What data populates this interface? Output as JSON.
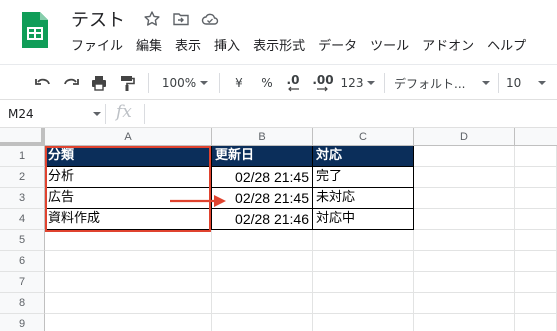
{
  "header": {
    "title": "テスト",
    "menu": [
      "ファイル",
      "編集",
      "表示",
      "挿入",
      "表示形式",
      "データ",
      "ツール",
      "アドオン",
      "ヘルプ"
    ]
  },
  "toolbar": {
    "zoom": "100%",
    "currency": "¥",
    "percent": "%",
    "decrease_decimal": ".0",
    "increase_decimal": ".00",
    "number_format": "123",
    "font": "デフォルト...",
    "font_size": "10"
  },
  "formula_bar": {
    "name_box": "M24",
    "fx": "fx"
  },
  "grid": {
    "columns": [
      "A",
      "B",
      "C",
      "D"
    ],
    "rows": [
      "1",
      "2",
      "3",
      "4",
      "5",
      "6",
      "7",
      "8",
      "9"
    ],
    "cells": [
      [
        "分類",
        "更新日",
        "対応"
      ],
      [
        "分析",
        "02/28 21:45",
        "完了"
      ],
      [
        "広告",
        "02/28 21:45",
        "未対応"
      ],
      [
        "資料作成",
        "02/28 21:46",
        "対応中"
      ]
    ]
  },
  "colors": {
    "header_fill": "#0b2e5a",
    "annotation": "#e0432f",
    "logo": "#0f9d58"
  }
}
